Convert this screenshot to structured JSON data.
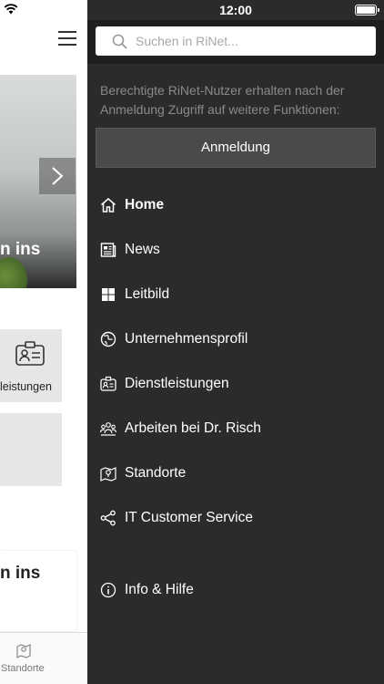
{
  "status": {
    "time": "12:00"
  },
  "background": {
    "hero_text": "n ins",
    "service_label": "leistungen",
    "news_text": "n ins",
    "tab_label": "Standorte"
  },
  "drawer": {
    "search_placeholder": "Suchen in RiNet...",
    "info_text": "Berechtigte RiNet-Nutzer erhalten nach der Anmeldung Zugriff auf weitere Funktionen:",
    "login_label": "Anmeldung",
    "menu": [
      {
        "label": "Home",
        "icon": "home-icon"
      },
      {
        "label": "News",
        "icon": "news-icon"
      },
      {
        "label": "Leitbild",
        "icon": "grid-icon"
      },
      {
        "label": "Unternehmensprofil",
        "icon": "globe-icon"
      },
      {
        "label": "Dienstleistungen",
        "icon": "id-card-icon"
      },
      {
        "label": "Arbeiten bei Dr. Risch",
        "icon": "team-icon"
      },
      {
        "label": "Standorte",
        "icon": "map-pin-icon"
      },
      {
        "label": "IT Customer Service",
        "icon": "share-icon"
      },
      {
        "label": "Info & Hilfe",
        "icon": "info-icon"
      }
    ]
  },
  "colors": {
    "drawer_bg": "#2b2b2b",
    "search_bar_bg": "#1f1f1f",
    "button_bg": "#4a4a4a",
    "info_text": "#8a8a8a"
  }
}
